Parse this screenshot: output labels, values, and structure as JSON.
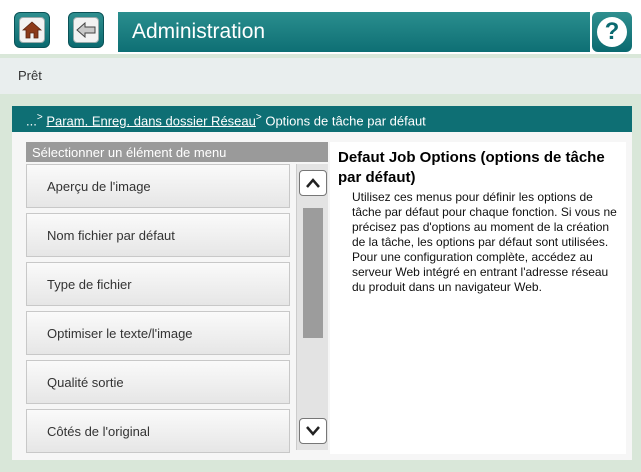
{
  "header": {
    "title": "Administration",
    "home_icon": "home-icon",
    "back_icon": "back-icon",
    "help_icon": "help-icon",
    "help_label": "?"
  },
  "status": {
    "text": "Prêt"
  },
  "breadcrumb": {
    "prefix": "...",
    "separator": ">",
    "link": "Param. Enreg. dans dossier Réseau",
    "current": "Options de tâche par défaut"
  },
  "menu": {
    "header": "Sélectionner un élément de menu",
    "items": [
      "Aperçu de l'image",
      "Nom fichier par défaut",
      "Type de fichier",
      "Optimiser le texte/l'image",
      "Qualité sortie",
      "Côtés de l'original"
    ]
  },
  "scrollbar": {
    "up_icon": "chevron-up-icon",
    "down_icon": "chevron-down-icon"
  },
  "description": {
    "title": "Defaut Job Options (options de tâche par défaut)",
    "body": "Utilisez ces menus pour définir les options de tâche par défaut pour chaque fonction. Si vous ne précisez pas d'options au moment de la création de la tâche, les options par défaut sont utilisées. Pour une configuration complète, accédez au serveur Web intégré en entrant l'adresse réseau du produit dans un navigateur Web."
  }
}
